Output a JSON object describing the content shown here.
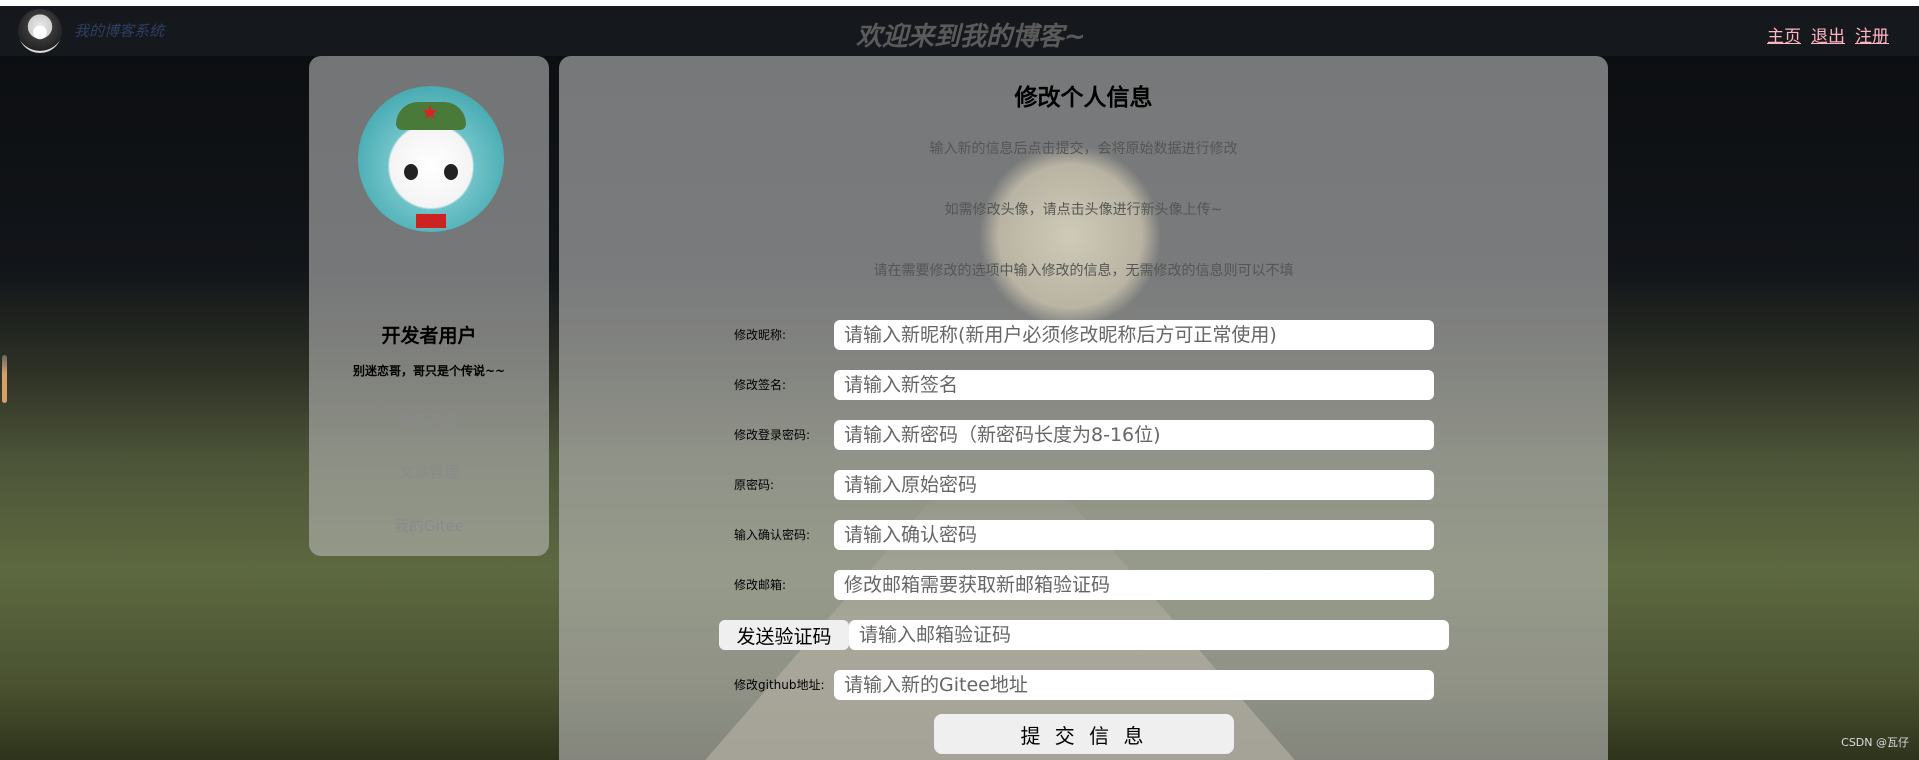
{
  "nav": {
    "brand": "我的博客系统",
    "welcome": "欢迎来到我的博客~",
    "links": [
      "主页",
      "退出",
      "注册"
    ]
  },
  "sidebar": {
    "user_name": "开发者用户",
    "signature": "别迷恋哥，哥只是个传说~~",
    "links": [
      "发布文章",
      "文章管理",
      "我的Gitee"
    ]
  },
  "form": {
    "title": "修改个人信息",
    "hints": [
      "输入新的信息后点击提交，会将原始数据进行修改",
      "如需修改头像，请点击头像进行新头像上传~",
      "请在需要修改的选项中输入修改的信息，无需修改的信息则可以不填"
    ],
    "fields": [
      {
        "label": "修改昵称:",
        "placeholder": "请输入新昵称(新用户必须修改昵称后方可正常使用)"
      },
      {
        "label": "修改签名:",
        "placeholder": "请输入新签名"
      },
      {
        "label": "修改登录密码:",
        "placeholder": "请输入新密码（新密码长度为8-16位)"
      },
      {
        "label": "原密码:",
        "placeholder": "请输入原始密码"
      },
      {
        "label": "输入确认密码:",
        "placeholder": "请输入确认密码"
      },
      {
        "label": "修改邮箱:",
        "placeholder": "修改邮箱需要获取新邮箱验证码"
      }
    ],
    "send_code_label": "发送验证码",
    "code_placeholder": "请输入邮箱验证码",
    "gitee": {
      "label": "修改github地址:",
      "placeholder": "请输入新的Gitee地址"
    },
    "submit_label": "提 交 信 息"
  },
  "watermark": "CSDN @瓦仔"
}
